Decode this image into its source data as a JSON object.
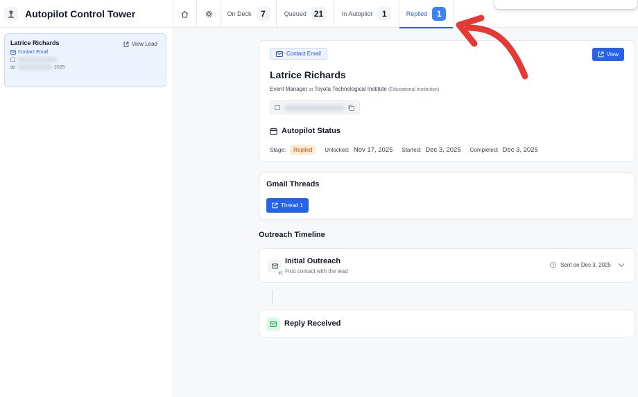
{
  "app": {
    "title": "Autopilot Control Tower"
  },
  "sidebar": {
    "lead": {
      "name": "Latrice Richards",
      "view_lead_label": "View Lead",
      "chip_label": "Contact Email",
      "row2_tail": "2025"
    }
  },
  "tabs": [
    {
      "label": "On Deck",
      "count": "7"
    },
    {
      "label": "Queued",
      "count": "21"
    },
    {
      "label": "In Autopilot",
      "count": "1"
    },
    {
      "label": "Replied",
      "count": "1"
    }
  ],
  "detail": {
    "badge": "Contact Email",
    "view_label": "View",
    "name": "Latrice Richards",
    "role": "Event Manager",
    "at_word": "at",
    "org": "Toyota Technological Institute",
    "org_type": "(Educational Institution)",
    "status_title": "Autopilot Status",
    "stage_label": "Stage:",
    "stage_value": "Replied",
    "unlocked_label": "Unlocked:",
    "unlocked_value": "Nov 17, 2025",
    "started_label": "Started:",
    "started_value": "Dec 3, 2025",
    "completed_label": "Completed:",
    "completed_value": "Dec 3, 2025"
  },
  "gmail": {
    "title": "Gmail Threads",
    "thread_label": "Thread 1"
  },
  "timeline": {
    "title": "Outreach Timeline",
    "item1": {
      "title": "Initial Outreach",
      "subtitle": "First contact with the lead",
      "badge": "#1",
      "sent": "Sent on Dec 3, 2025"
    },
    "item2": {
      "title": "Reply Received"
    }
  },
  "colors": {
    "accent": "#2563eb",
    "stage_bg": "#fdebd3",
    "annotation": "#e53935"
  }
}
